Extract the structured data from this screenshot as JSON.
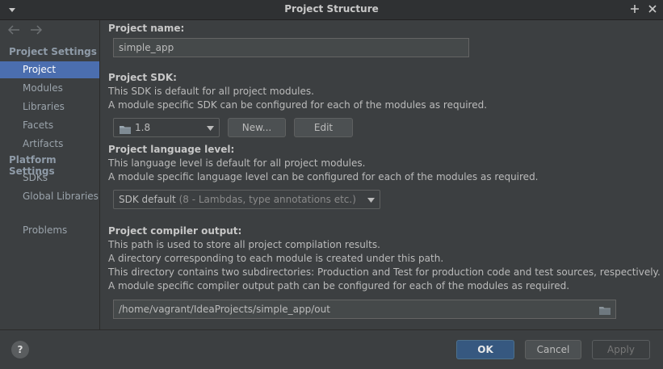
{
  "window": {
    "title": "Project Structure"
  },
  "sidebar": {
    "project_settings_header": "Project Settings",
    "project_settings_items": [
      {
        "label": "Project",
        "active": true
      },
      {
        "label": "Modules"
      },
      {
        "label": "Libraries"
      },
      {
        "label": "Facets"
      },
      {
        "label": "Artifacts"
      }
    ],
    "platform_settings_header": "Platform Settings",
    "platform_settings_items": [
      {
        "label": "SDKs"
      },
      {
        "label": "Global Libraries"
      }
    ],
    "problems_label": "Problems"
  },
  "project_name": {
    "label": "Project name:",
    "value": "simple_app"
  },
  "project_sdk": {
    "label": "Project SDK:",
    "desc1": "This SDK is default for all project modules.",
    "desc2": "A module specific SDK can be configured for each of the modules as required.",
    "selected": "1.8",
    "new_button": "New...",
    "edit_button": "Edit"
  },
  "language_level": {
    "label": "Project language level:",
    "desc1": "This language level is default for all project modules.",
    "desc2": "A module specific language level can be configured for each of the modules as required.",
    "selected_main": "SDK default",
    "selected_detail": "(8 - Lambdas, type annotations etc.)"
  },
  "compiler_output": {
    "label": "Project compiler output:",
    "desc1": "This path is used to store all project compilation results.",
    "desc2": "A directory corresponding to each module is created under this path.",
    "desc3": "This directory contains two subdirectories: Production and Test for production code and test sources, respectively.",
    "desc4": "A module specific compiler output path can be configured for each of the modules as required.",
    "path": "/home/vagrant/IdeaProjects/simple_app/out"
  },
  "footer": {
    "help": "?",
    "ok": "OK",
    "cancel": "Cancel",
    "apply": "Apply"
  },
  "colors": {
    "accent": "#4b6eaf",
    "ok_button": "#365880",
    "background": "#3c3f41"
  }
}
